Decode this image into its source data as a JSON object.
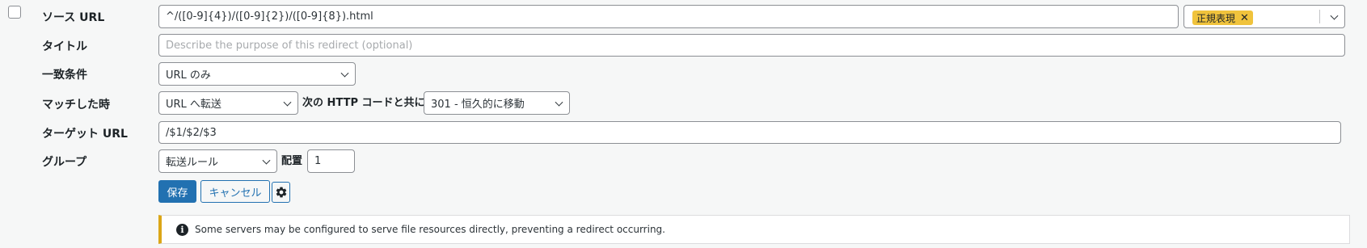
{
  "form": {
    "source_url": {
      "label": "ソース URL",
      "value": "^/([0-9]{4})/([0-9]{2})/([0-9]{8}).html",
      "options_tag": "正規表現"
    },
    "title": {
      "label": "タイトル",
      "placeholder": "Describe the purpose of this redirect (optional)"
    },
    "match": {
      "label": "一致条件",
      "value": "URL のみ"
    },
    "action": {
      "label": "マッチした時",
      "value": "URL へ転送",
      "http_code_label": "次の HTTP コードと共に",
      "http_code_value": "301 - 恒久的に移動"
    },
    "target_url": {
      "label": "ターゲット URL",
      "value": "/$1/$2/$3"
    },
    "group": {
      "label": "グループ",
      "value": "転送ルール",
      "position_label": "配置",
      "position_value": "1"
    },
    "buttons": {
      "save": "保存",
      "cancel": "キャンセル"
    },
    "notice": "Some servers may be configured to serve file resources directly, preventing a redirect occurring."
  }
}
